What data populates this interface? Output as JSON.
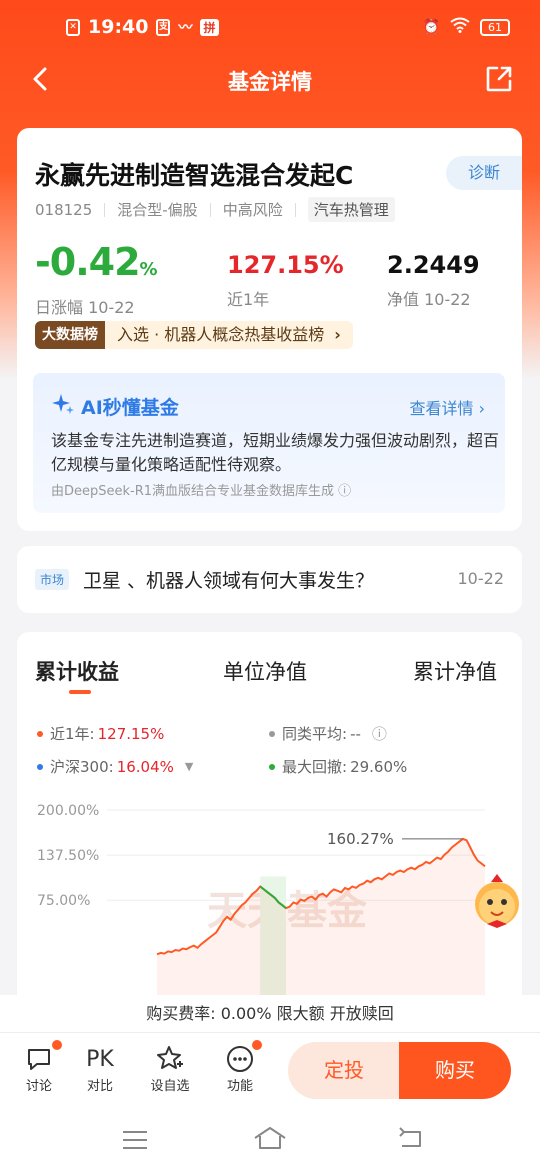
{
  "status_bar": {
    "time": "19:40",
    "battery": "61"
  },
  "nav": {
    "title": "基金详情"
  },
  "fund": {
    "name": "永赢先进制造智选混合发起C",
    "diagnose_label": "诊断",
    "code": "018125",
    "type": "混合型-偏股",
    "risk": "中高风险",
    "theme": "汽车热管理",
    "daily_change_value": "-0.42",
    "daily_change_unit": "%",
    "daily_change_label": "日涨幅  10-22",
    "year_return_value": "127.15%",
    "year_return_label": "近1年",
    "nav_value": "2.2449",
    "nav_label": "净值  10-22",
    "rank_tag": "大数据榜",
    "rank_text": "入选 · 机器人概念热基收益榜"
  },
  "ai": {
    "title": "AI秒懂基金",
    "more": "查看详情",
    "body": "该基金专注先进制造赛道，短期业绩爆发力强但波动剧烈，超百亿规模与量化策略适配性待观察。",
    "footer": "由DeepSeek-R1满血版结合专业基金数据库生成"
  },
  "news": {
    "tag": "市场",
    "text": "卫星 、机器人领域有何大事发生？",
    "date": "10-22"
  },
  "chart_tabs": [
    "累计收益",
    "单位净值",
    "累计净值"
  ],
  "legend": {
    "l1_label": "近1年:",
    "l1_value": "127.15%",
    "l2_label": "同类平均:",
    "l2_value": "--",
    "l3_label": "沪深300:",
    "l3_value": "16.04%",
    "l4_label": "最大回撤:",
    "l4_value": "29.60%"
  },
  "colors": {
    "accent": "#ff5a26",
    "up": "#e5262a",
    "down": "#2caa3c",
    "link": "#3d86d0"
  },
  "chart_data": {
    "type": "line",
    "y_ticks": [
      "200.00%",
      "137.50%",
      "75.00%"
    ],
    "ylim": [
      0,
      200
    ],
    "peak_label": "160.27%",
    "watermark": "天天基金",
    "series": [
      {
        "values": [
          0,
          2,
          1,
          4,
          3,
          6,
          5,
          8,
          7,
          10,
          12,
          9,
          14,
          18,
          22,
          26,
          30,
          38,
          46,
          52,
          48,
          56,
          62,
          68,
          72,
          78,
          84,
          88,
          94,
          90,
          86,
          82,
          78,
          72,
          68,
          64,
          66,
          72,
          70,
          76,
          74,
          78,
          80,
          76,
          82,
          84,
          80,
          86,
          90,
          88,
          86,
          92,
          90,
          94,
          92,
          96,
          98,
          102,
          100,
          104,
          106,
          104,
          108,
          112,
          110,
          114,
          116,
          114,
          118,
          120,
          118,
          122,
          124,
          128,
          126,
          130,
          134,
          132,
          138,
          142,
          148,
          152,
          156,
          160,
          158,
          148,
          138,
          130,
          126,
          122
        ]
      }
    ]
  },
  "fee_text": "购买费率: 0.00%  限大额  开放赎回",
  "bottom": {
    "discuss": "讨论",
    "pk_icon": "PK",
    "pk": "对比",
    "watch": "设自选",
    "func": "功能",
    "sip": "定投",
    "buy": "购买"
  }
}
